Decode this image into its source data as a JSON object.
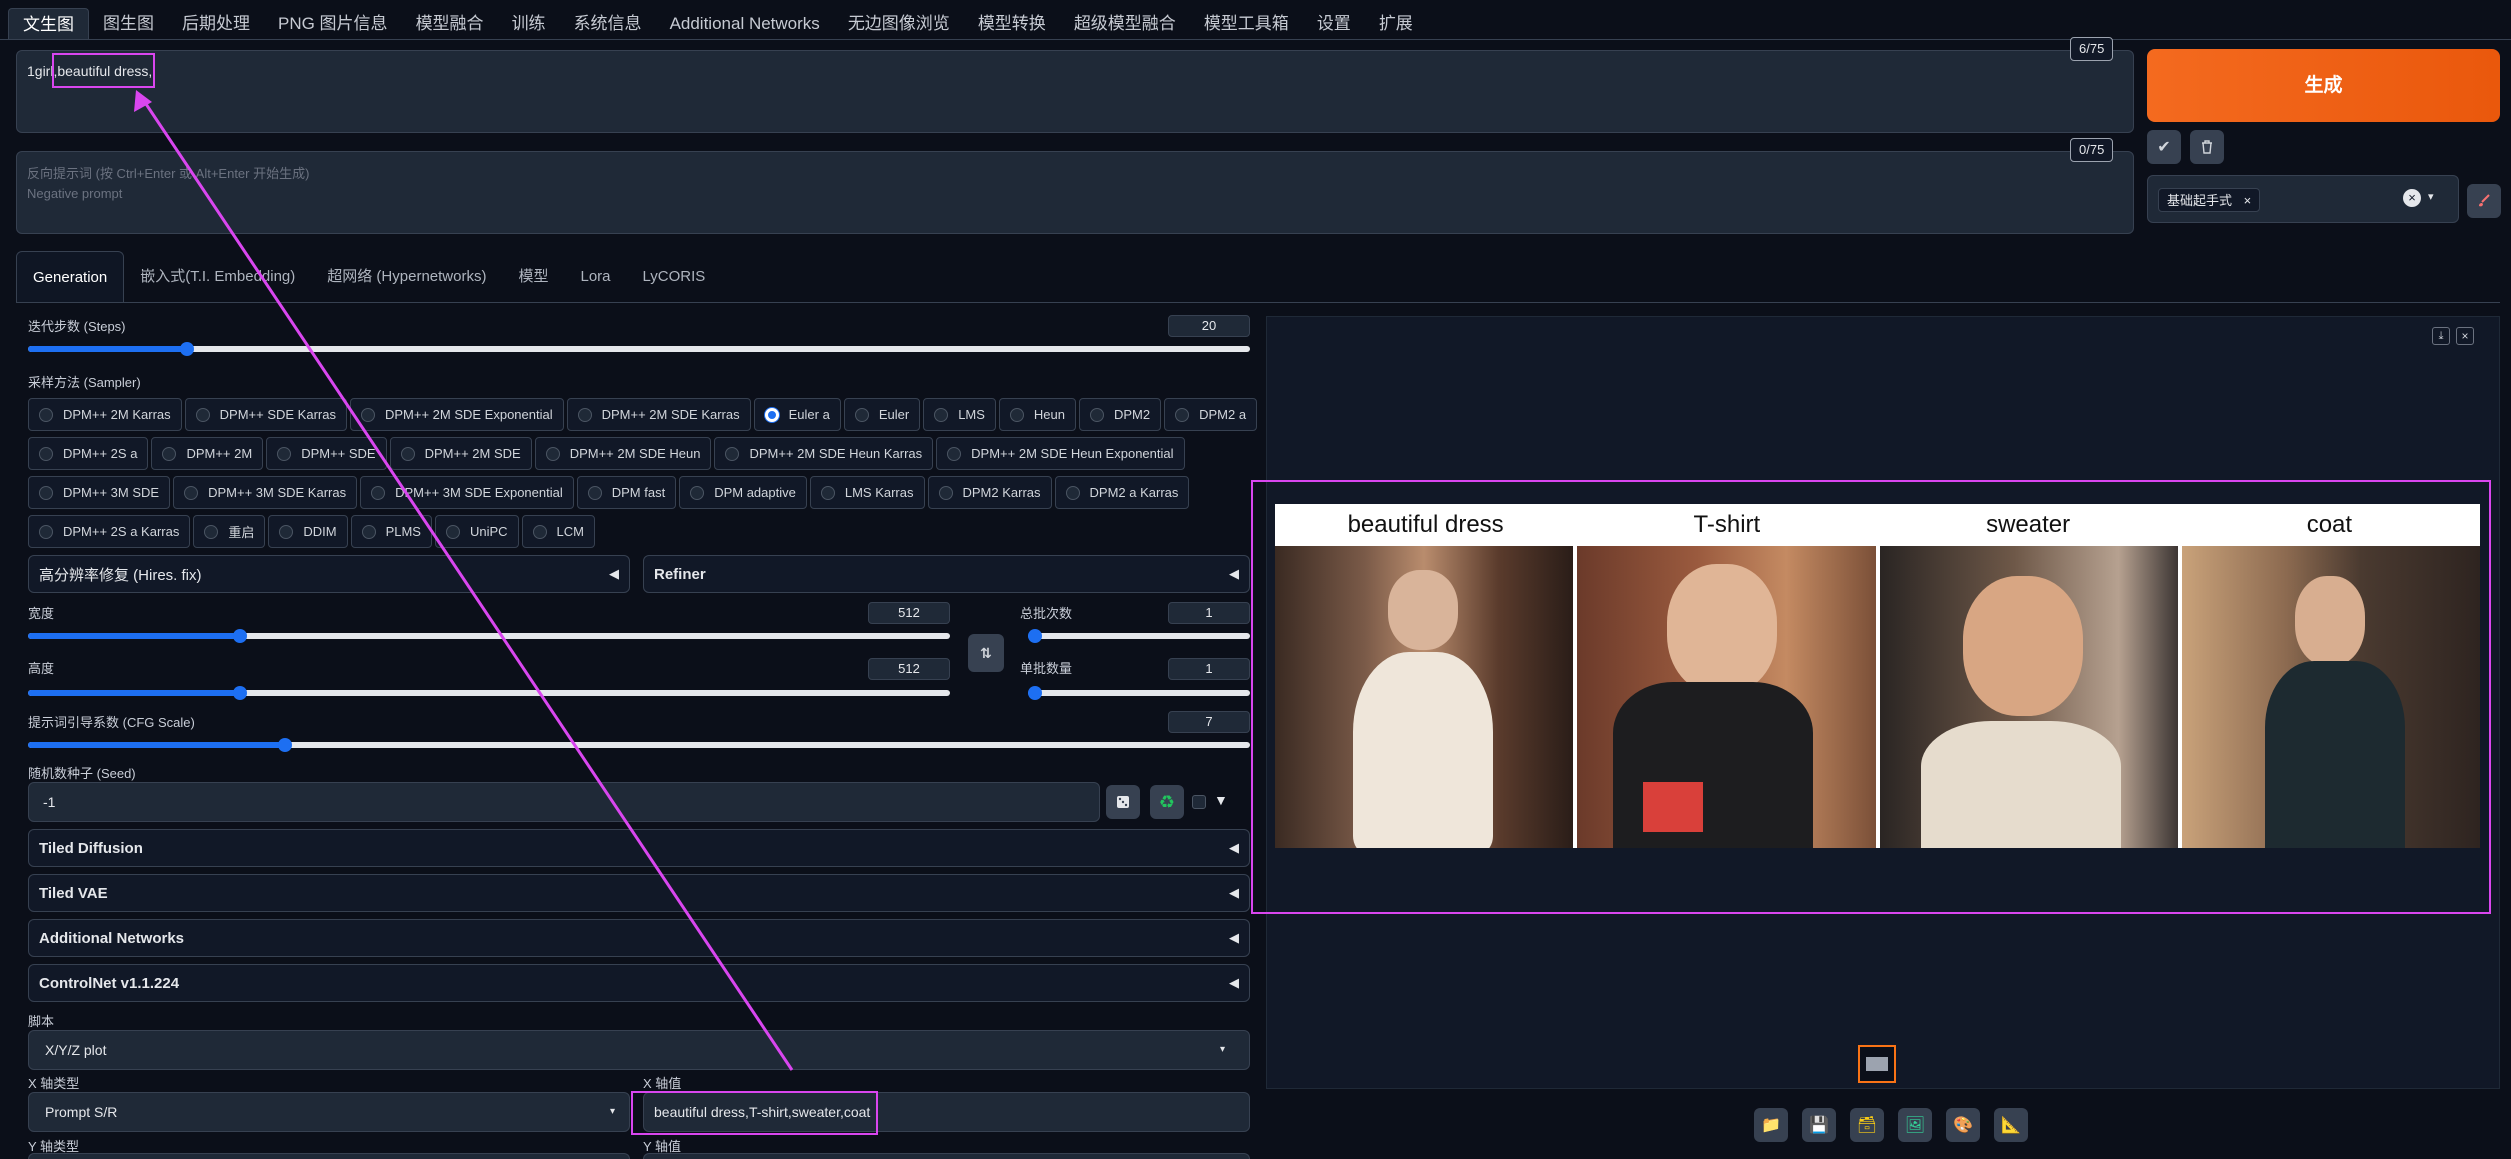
{
  "top_tabs": [
    "文生图",
    "图生图",
    "后期处理",
    "PNG 图片信息",
    "模型融合",
    "训练",
    "系统信息",
    "Additional Networks",
    "无边图像浏览",
    "模型转换",
    "超级模型融合",
    "模型工具箱",
    "设置",
    "扩展"
  ],
  "prompt": {
    "value": "1girl,beautiful dress,",
    "token_count": "6/75"
  },
  "negative_prompt": {
    "placeholder_line1": "反向提示词 (按 Ctrl+Enter 或 Alt+Enter 开始生成)",
    "placeholder_line2": "Negative prompt",
    "token_count": "0/75"
  },
  "generate_label": "生成",
  "styles": {
    "selected_tag": "基础起手式"
  },
  "settings_tabs": [
    "Generation",
    "嵌入式(T.I. Embedding)",
    "超网络 (Hypernetworks)",
    "模型",
    "Lora",
    "LyCORIS"
  ],
  "steps": {
    "label": "迭代步数 (Steps)",
    "value": "20",
    "fraction": 0.13
  },
  "sampler": {
    "label": "采样方法 (Sampler)",
    "selected": "Euler a",
    "rows": [
      [
        "DPM++ 2M Karras",
        "DPM++ SDE Karras",
        "DPM++ 2M SDE Exponential",
        "DPM++ 2M SDE Karras",
        "Euler a",
        "Euler",
        "LMS",
        "Heun",
        "DPM2",
        "DPM2 a"
      ],
      [
        "DPM++ 2S a",
        "DPM++ 2M",
        "DPM++ SDE",
        "DPM++ 2M SDE",
        "DPM++ 2M SDE Heun",
        "DPM++ 2M SDE Heun Karras",
        "DPM++ 2M SDE Heun Exponential"
      ],
      [
        "DPM++ 3M SDE",
        "DPM++ 3M SDE Karras",
        "DPM++ 3M SDE Exponential",
        "DPM fast",
        "DPM adaptive",
        "LMS Karras",
        "DPM2 Karras",
        "DPM2 a Karras"
      ],
      [
        "DPM++ 2S a Karras",
        "重启",
        "DDIM",
        "PLMS",
        "UniPC",
        "LCM"
      ]
    ]
  },
  "hires_fix": {
    "label": "高分辨率修复 (Hires. fix)"
  },
  "refiner": {
    "label": "Refiner"
  },
  "width": {
    "label": "宽度",
    "value": "512",
    "fraction": 0.23
  },
  "height": {
    "label": "高度",
    "value": "512",
    "fraction": 0.23
  },
  "batch_count": {
    "label": "总批次数",
    "value": "1",
    "fraction": 0.0
  },
  "batch_size": {
    "label": "单批数量",
    "value": "1",
    "fraction": 0.0
  },
  "cfg": {
    "label": "提示词引导系数 (CFG Scale)",
    "value": "7",
    "fraction": 0.21
  },
  "seed": {
    "label": "随机数种子 (Seed)",
    "value": "-1"
  },
  "accordions": [
    "Tiled Diffusion",
    "Tiled VAE",
    "Additional Networks",
    "ControlNet v1.1.224"
  ],
  "script": {
    "label": "脚本",
    "value": "X/Y/Z plot"
  },
  "x_axis": {
    "type_label": "X 轴类型",
    "type_value": "Prompt S/R",
    "values_label": "X 轴值",
    "values_value": "beautiful dress,T-shirt,sweater,coat"
  },
  "y_axis": {
    "type_label": "Y 轴类型",
    "values_label": "Y 轴值"
  },
  "grid": {
    "labels": [
      "beautiful dress",
      "T-shirt",
      "sweater",
      "coat"
    ]
  },
  "colors": {
    "accent": "#1d6ff2",
    "generate": "#ea580c",
    "highlight": "#d946ef"
  }
}
